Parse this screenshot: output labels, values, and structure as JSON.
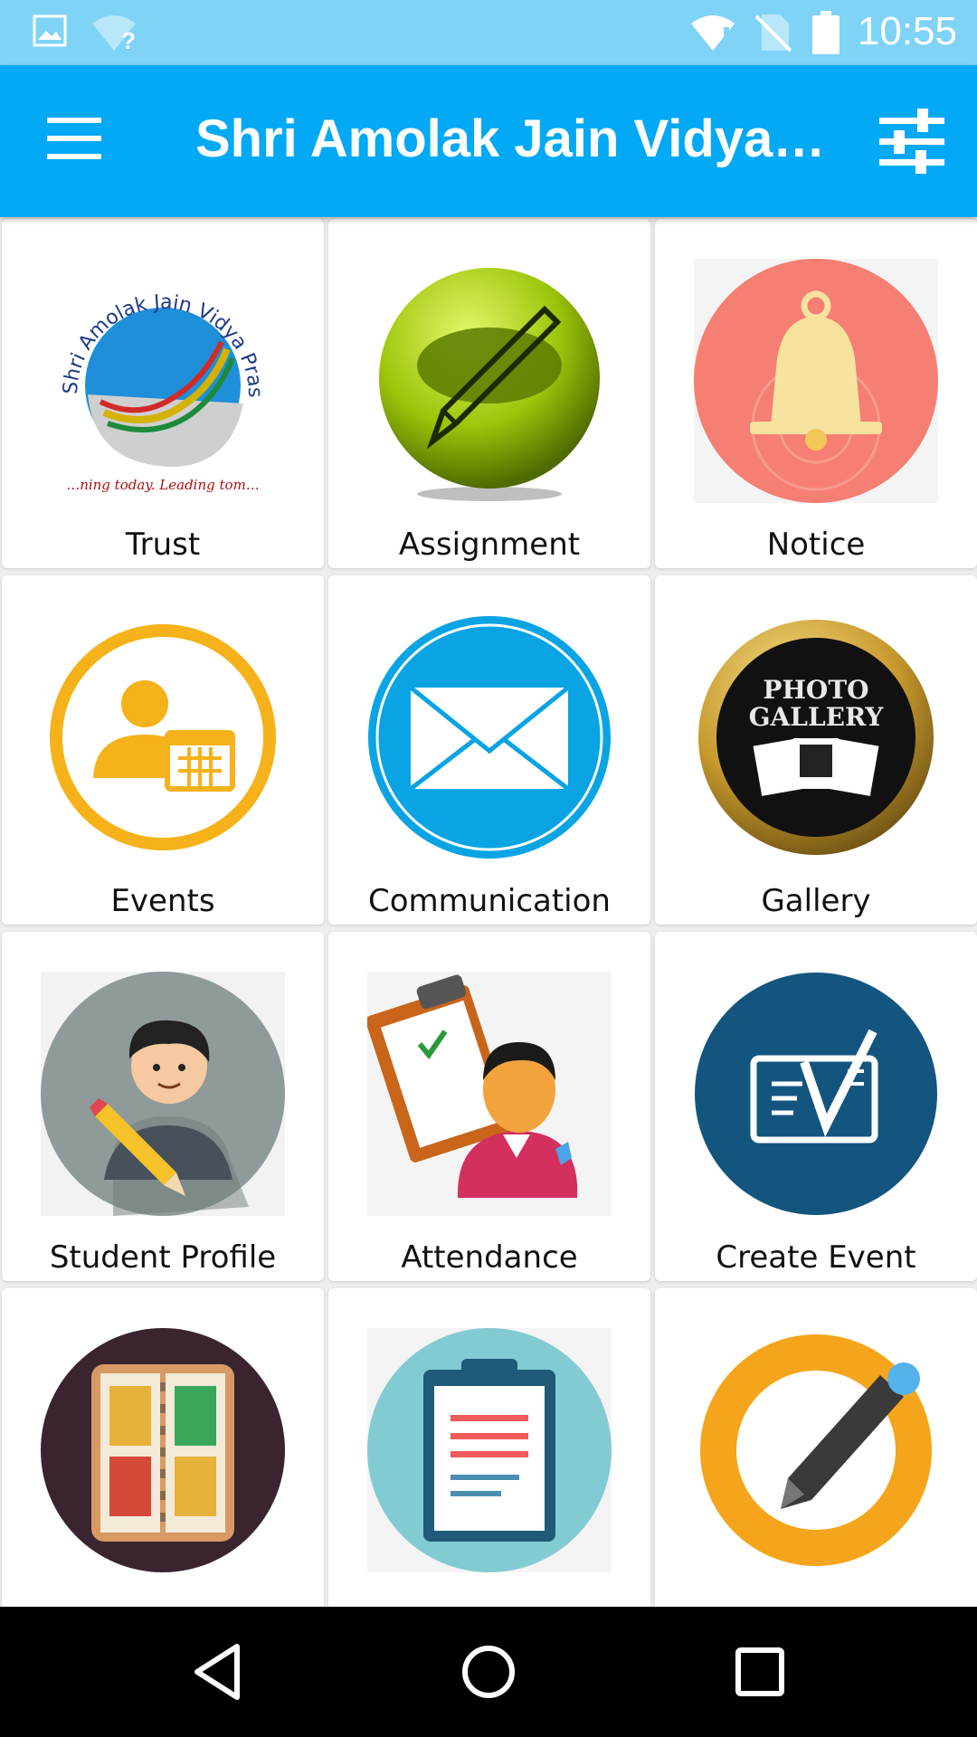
{
  "status_bar": {
    "time": "10:55"
  },
  "app_bar": {
    "title": "Shri Amolak Jain Vidya…"
  },
  "tiles": [
    {
      "label": "Trust",
      "icon": "trust-logo-icon",
      "logo_text": "Shri Amolak Jain Vidya Prasarak Mandal",
      "tagline": "…ning today. Leading tom…"
    },
    {
      "label": "Assignment",
      "icon": "pencil-icon"
    },
    {
      "label": "Notice",
      "icon": "bell-icon"
    },
    {
      "label": "Events",
      "icon": "user-calendar-icon"
    },
    {
      "label": "Communication",
      "icon": "envelope-icon"
    },
    {
      "label": "Gallery",
      "icon": "photo-gallery-icon",
      "badge_line1": "PHOTO",
      "badge_line2": "GALLERY"
    },
    {
      "label": "Student Profile",
      "icon": "student-icon"
    },
    {
      "label": "Attendance",
      "icon": "clipboard-person-icon"
    },
    {
      "label": "Create Event",
      "icon": "checked-card-icon"
    },
    {
      "label": "",
      "icon": "photo-album-icon"
    },
    {
      "label": "",
      "icon": "clipboard-icon"
    },
    {
      "label": "",
      "icon": "edit-ring-icon"
    }
  ],
  "colors": {
    "status_bar": "#7fd3f6",
    "app_bar": "#03a9f4",
    "nav_bar": "#000000"
  }
}
